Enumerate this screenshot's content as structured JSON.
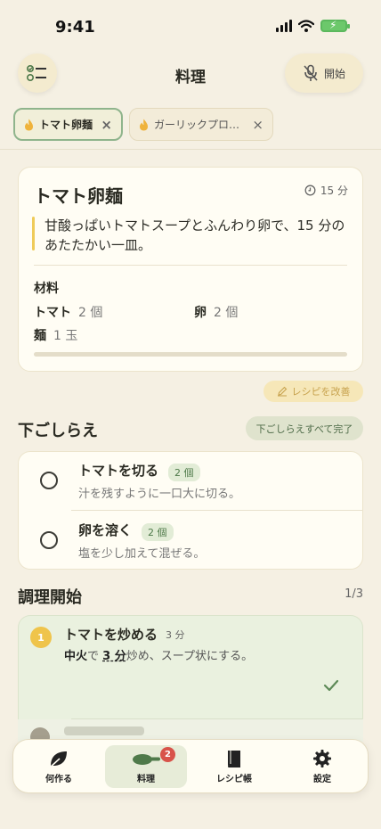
{
  "status_bar": {
    "time": "9:41"
  },
  "header": {
    "title": "料理",
    "start_label": "開始"
  },
  "tabs": [
    {
      "label": "トマト卵麺",
      "close": "×"
    },
    {
      "label": "ガーリックプロ…",
      "close": "×"
    }
  ],
  "recipe": {
    "title": "トマト卵麺",
    "time": "15 分",
    "description": "甘酸っぱいトマトスープとふんわり卵で、15 分のあたたかい一皿。",
    "ingredients_heading": "材料",
    "ingredients": [
      {
        "name": "トマト",
        "qty": "2 個"
      },
      {
        "name": "卵",
        "qty": "2 個"
      },
      {
        "name": "麺",
        "qty": "1 玉"
      }
    ],
    "progress": 0
  },
  "improve_label": "レシピを改善",
  "prep": {
    "title": "下ごしらえ",
    "complete_all_label": "下ごしらえすべて完了",
    "items": [
      {
        "name": "トマトを切る",
        "qty": "2 個",
        "note": "汁を残すように一口大に切る。"
      },
      {
        "name": "卵を溶く",
        "qty": "2 個",
        "note": "塩を少し加えて混ぜる。"
      }
    ]
  },
  "cooking": {
    "title": "調理開始",
    "count": "1/3",
    "step": {
      "number": "1",
      "name": "トマトを炒める",
      "duration": "3 分",
      "heat": "中火",
      "desc_mid": "で",
      "time_highlight": "3 分",
      "desc_rest": "炒め、スープ状にする。"
    }
  },
  "nav": {
    "items": [
      {
        "label": "何作る"
      },
      {
        "label": "料理",
        "badge": "2"
      },
      {
        "label": "レシピ帳"
      },
      {
        "label": "設定"
      }
    ]
  },
  "colors": {
    "accent_green": "#5e8a58",
    "accent_yellow": "#efc44b",
    "background": "#f5f0e3",
    "badge_red": "#d8534a"
  }
}
